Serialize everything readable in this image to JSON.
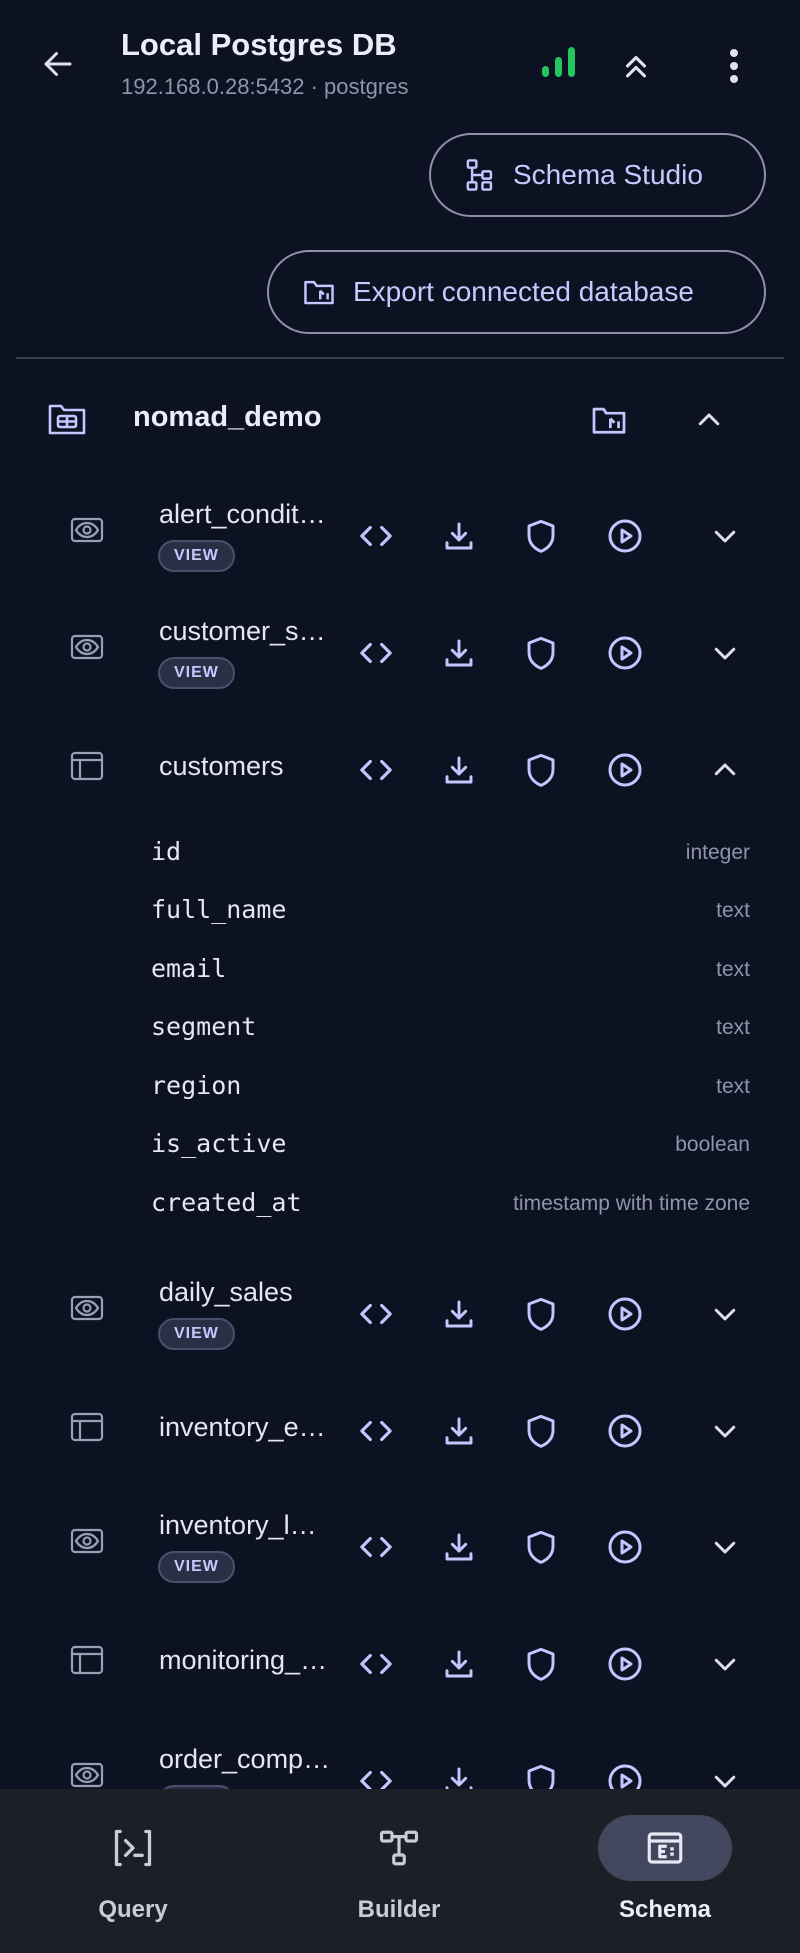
{
  "header": {
    "title": "Local Postgres DB",
    "subtitle": "192.168.0.28:5432 · postgres",
    "signal_color": "#22c55e"
  },
  "actions": {
    "schema_studio": "Schema Studio",
    "export": "Export connected database"
  },
  "schema": {
    "name": "nomad_demo"
  },
  "badge_label": "VIEW",
  "objects": [
    {
      "name": "alert_conditions",
      "kind": "view"
    },
    {
      "name": "customer_summary",
      "kind": "view"
    },
    {
      "name": "customers",
      "kind": "table",
      "expanded": true
    },
    {
      "name": "daily_sales",
      "kind": "view"
    },
    {
      "name": "inventory_events",
      "kind": "table"
    },
    {
      "name": "inventory_levels",
      "kind": "view"
    },
    {
      "name": "monitoring_events",
      "kind": "table"
    },
    {
      "name": "order_completions",
      "kind": "view"
    }
  ],
  "customers_columns": [
    {
      "name": "id",
      "type": "integer"
    },
    {
      "name": "full_name",
      "type": "text"
    },
    {
      "name": "email",
      "type": "text"
    },
    {
      "name": "segment",
      "type": "text"
    },
    {
      "name": "region",
      "type": "text"
    },
    {
      "name": "is_active",
      "type": "boolean"
    },
    {
      "name": "created_at",
      "type": "timestamp with time zone"
    }
  ],
  "nav": {
    "query": "Query",
    "builder": "Builder",
    "schema": "Schema",
    "active": "schema"
  }
}
